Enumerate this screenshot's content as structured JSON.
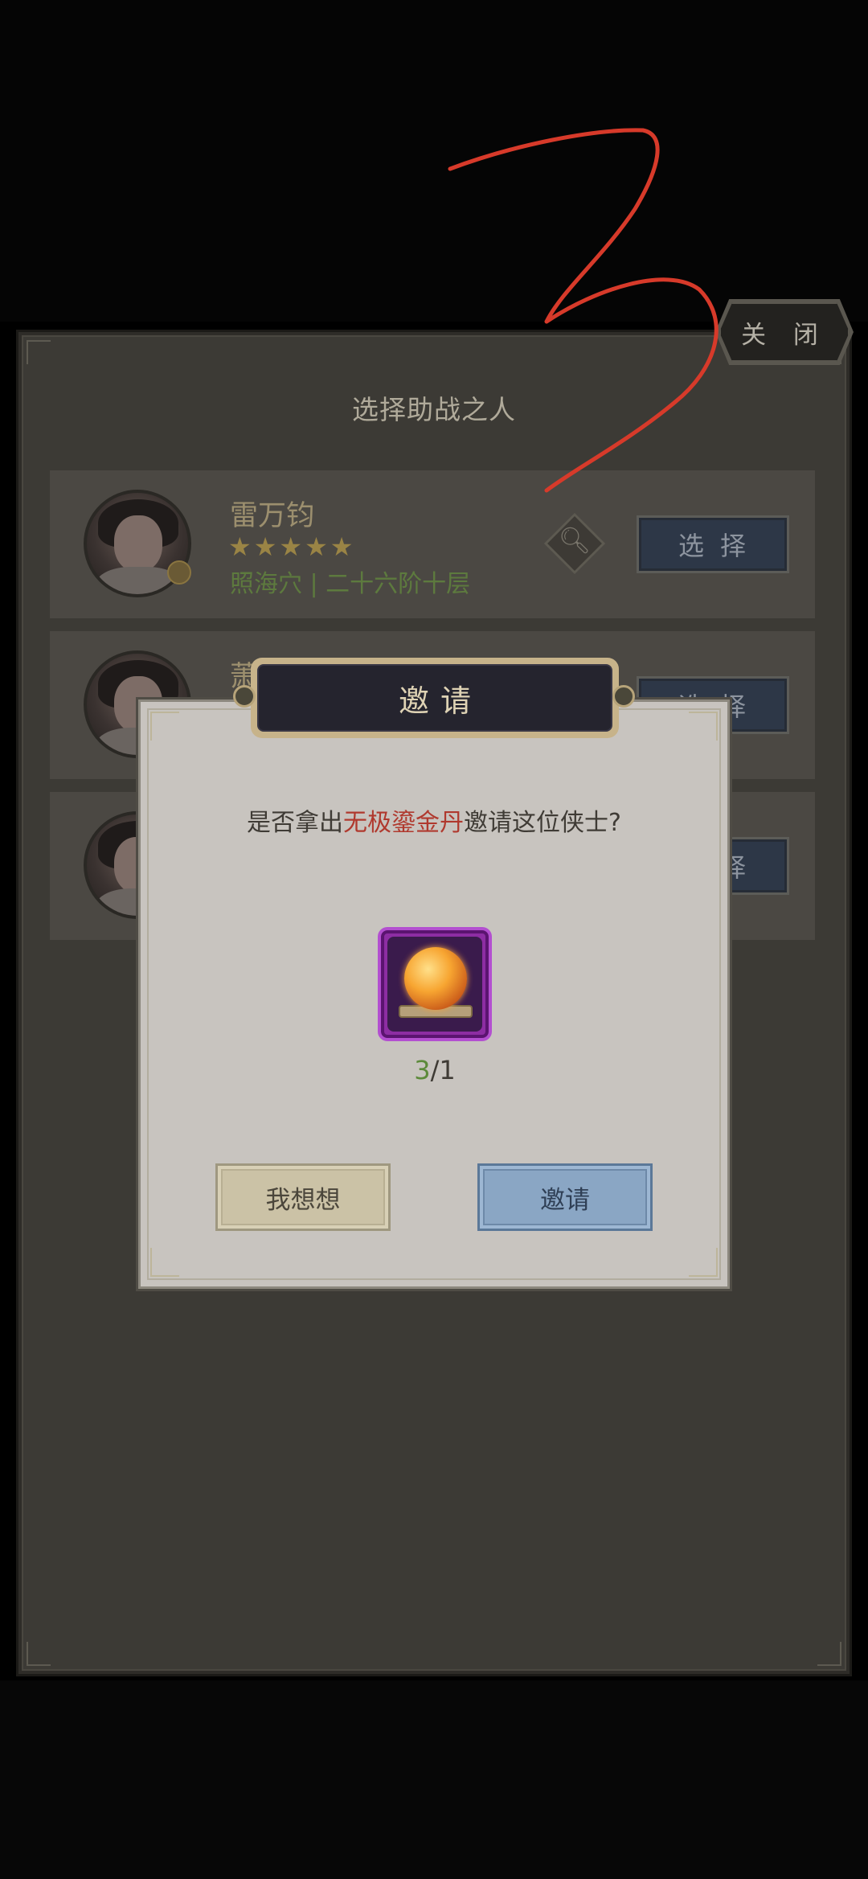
{
  "close_label": "关 闭",
  "panel_title": "选择助战之人",
  "rows": [
    {
      "name": "雷万钧",
      "stars": "★★★★★",
      "location": "照海穴 | 二十六阶十层",
      "select": "选择"
    },
    {
      "name": "萧",
      "select": "选择"
    },
    {
      "select": "选择"
    }
  ],
  "dialog": {
    "title": "邀请",
    "question_prefix": "是否拿出",
    "item_name": "无极鎏金丹",
    "question_suffix": "邀请这位侠士?",
    "item_icon": "golden-pill-orb",
    "count_current": "3",
    "count_sep": "/",
    "count_required": "1",
    "cancel_label": "我想想",
    "confirm_label": "邀请"
  },
  "colors": {
    "highlight_red": "#b0392e",
    "count_green": "#5c8a3a",
    "scribble_red": "#d73a2a"
  }
}
